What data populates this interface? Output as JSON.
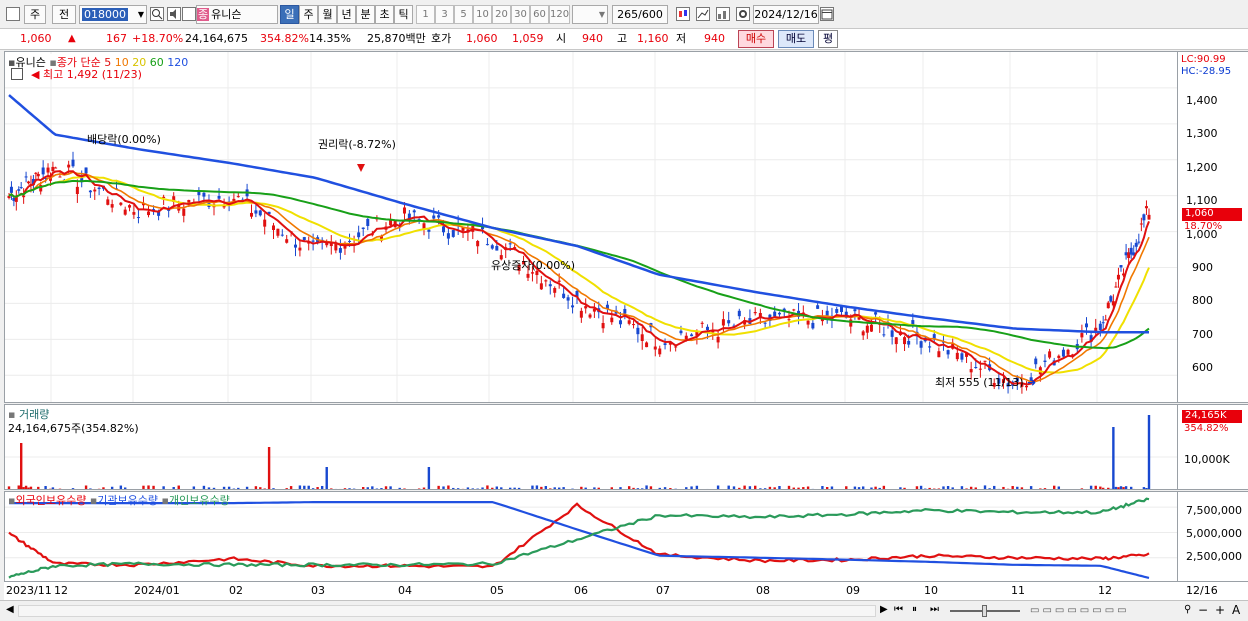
{
  "toolbar": {
    "mode1": "주",
    "mode2": "전",
    "code": "018000",
    "stock_name": "유니슨",
    "stock_prefix": "종",
    "periods": [
      "일",
      "주",
      "월",
      "년",
      "분",
      "초",
      "틱"
    ],
    "active_period": "일",
    "intervals": [
      "1",
      "3",
      "5",
      "10",
      "20",
      "30",
      "60",
      "120"
    ],
    "count": "265",
    "count_total": "/600",
    "date": "2024/12/16"
  },
  "pricebar": {
    "price": "1,060",
    "arrow": "▲",
    "change": "167",
    "change_pct": "+18.70%",
    "volume": "24,164,675",
    "volume_pct": "354.82%",
    "turnover": "14.35%",
    "amount": "25,870백만",
    "hoga_label": "호가",
    "ask": "1,060",
    "bid": "1,059",
    "open_label": "시",
    "open": "940",
    "high_label": "고",
    "high": "1,160",
    "low_label": "저",
    "low": "940",
    "buy": "매수",
    "sell": "매도",
    "eval": "평"
  },
  "price_pane": {
    "name": "유니슨",
    "ma_label": "종가 단순",
    "ma": [
      "5",
      "10",
      "20",
      "60",
      "120"
    ],
    "ma_colors": [
      "#e01010",
      "#f07800",
      "#f0e000",
      "#18a018",
      "#2050e0"
    ],
    "high_note": "최고 1,492 (11/23)",
    "low_note": "최저 555 (11/13)",
    "events": [
      "배당락(0.00%)",
      "권리락(-8.72%)",
      "유상증자(0.00%)"
    ],
    "lc": "LC:90.99",
    "hc": "HC:-28.95",
    "y_ticks": [
      "1,400",
      "1,300",
      "1,200",
      "1,100",
      "1,000",
      "900",
      "800",
      "700",
      "600"
    ],
    "last_price": "1,060",
    "last_pct": "18.70%"
  },
  "volume_pane": {
    "name": "거래량",
    "value": "24,164,675주(354.82%)",
    "tick": "10,000K",
    "last_vol": "24,165K",
    "last_pct": "354.82%"
  },
  "holding_pane": {
    "names": [
      "외국인보유수량",
      "기관보유수량",
      "개인보유수량"
    ],
    "colors": [
      "#e01010",
      "#2050e0",
      "#2a9a5a"
    ],
    "y_ticks": [
      "7,500,000",
      "5,000,000",
      "2,500,000"
    ]
  },
  "x_axis": [
    "2023/11",
    "12",
    "2024/01",
    "02",
    "03",
    "04",
    "05",
    "06",
    "07",
    "08",
    "09",
    "10",
    "11",
    "12",
    "12/16"
  ],
  "chart_data": {
    "type": "line",
    "title": "유니슨",
    "x": [
      "2023/11",
      "12",
      "2024/01",
      "02",
      "03",
      "04",
      "05",
      "06",
      "07",
      "08",
      "09",
      "10",
      "11",
      "12",
      "12/16"
    ],
    "series": [
      {
        "name": "종가",
        "values": [
          1100,
          1180,
          1060,
          1100,
          940,
          1040,
          980,
          810,
          700,
          750,
          760,
          700,
          575,
          740,
          1060
        ]
      },
      {
        "name": "120",
        "values": [
          1380,
          1270,
          1230,
          1190,
          1150,
          1080,
          1010,
          960,
          880,
          830,
          790,
          760,
          730,
          720,
          720
        ]
      }
    ],
    "ylim": [
      555,
      1492
    ],
    "high": 1492,
    "low": 555,
    "volume_last": 24164675,
    "holdings": {
      "외국인보유수량": [
        4900000,
        1900000,
        1800000,
        2400000,
        1700000,
        1700000,
        1600000,
        7700000,
        2800000,
        2200000,
        2300000,
        2700000,
        2500000,
        2400000,
        2800000
      ],
      "기관보유수량": [
        7900000,
        7900000,
        7900000,
        7900000,
        8000000,
        8000000,
        8000000,
        5300000,
        2700000,
        2500000,
        2300000,
        2100000,
        1800000,
        1700000,
        500000
      ],
      "개인보유수량": [
        600000,
        1700000,
        1900000,
        1800000,
        1800000,
        1800000,
        1900000,
        4300000,
        6700000,
        6500000,
        6800000,
        7200000,
        7000000,
        7000000,
        8300000
      ]
    }
  },
  "nav": {
    "zoom_out": "−",
    "zoom_in": "+",
    "font": "A"
  }
}
